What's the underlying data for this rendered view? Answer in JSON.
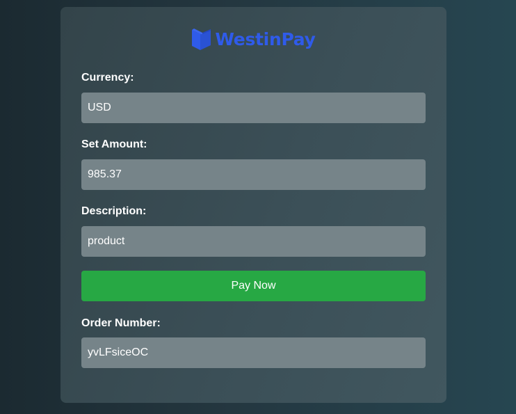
{
  "brand": {
    "name": "WestinPay",
    "icon": "open-book-logo-icon",
    "color": "#2f5bea"
  },
  "form": {
    "currency": {
      "label": "Currency:",
      "value": "USD"
    },
    "amount": {
      "label": "Set Amount:",
      "value": "985.37"
    },
    "description": {
      "label": "Description:",
      "value": "product"
    },
    "pay_button": {
      "label": "Pay Now",
      "color": "#27a844"
    },
    "order_number": {
      "label": "Order Number:",
      "value": "yvLFsiceOC"
    }
  }
}
